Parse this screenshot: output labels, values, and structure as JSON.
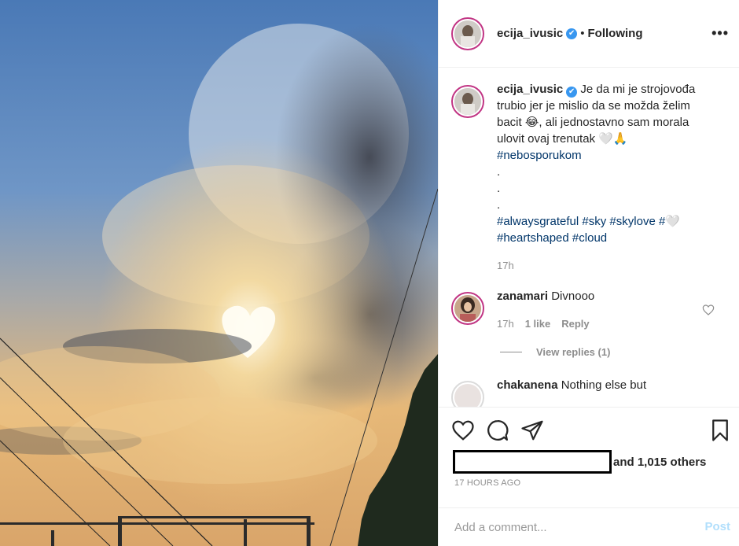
{
  "post": {
    "username": "ecija_ivusic",
    "verified_mark": "✔",
    "separator": "•",
    "follow_status": "Following",
    "more_icon": "•••"
  },
  "caption": {
    "username": "ecija_ivusic",
    "text_1": "Je da mi je strojovođa trubio jer je mislio da se možda želim bacit 😂, ali jednostavno sam morala ulovit ovaj trenutak 🤍🙏",
    "hashtag_1": "#nebosporukom",
    "dots": [
      ".",
      ".",
      "."
    ],
    "hashtags_2": [
      "#alwaysgrateful",
      "#sky",
      "#skylove",
      "#🤍",
      "#heartshaped",
      "#cloud"
    ],
    "time": "17h"
  },
  "comment_1": {
    "username": "zanamari",
    "text": "Divnooo",
    "time": "17h",
    "likes": "1 like",
    "reply": "Reply",
    "view_replies": "View replies (1)"
  },
  "comment_2": {
    "username": "chakanena",
    "text": "Nothing else but"
  },
  "actions": {
    "likes_text": "and 1,015 others",
    "timestamp": "17 HOURS AGO"
  },
  "add_comment": {
    "placeholder": "Add a comment...",
    "post_label": "Post"
  },
  "colors": {
    "link_blue": "#003569",
    "verified_blue": "#3897f0",
    "post_disabled": "#b2dffc",
    "story_ring": "#c13584"
  }
}
